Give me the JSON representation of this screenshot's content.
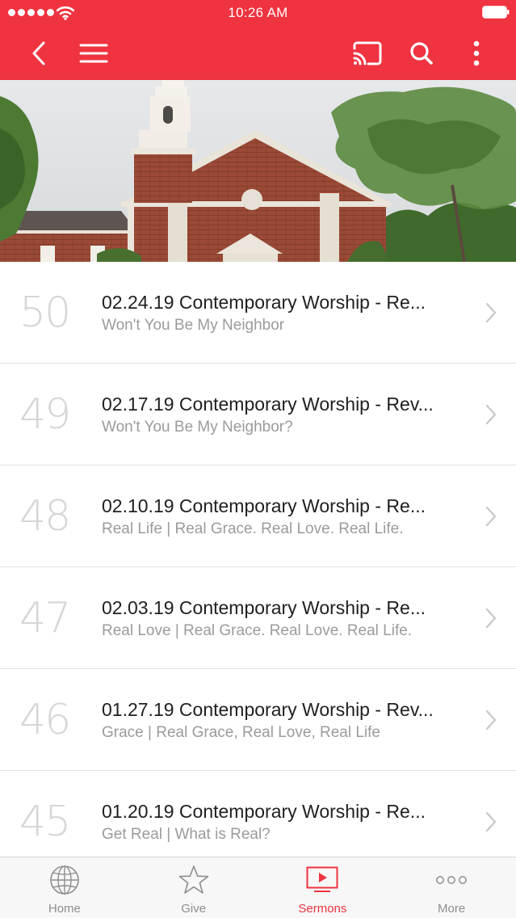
{
  "colors": {
    "accent": "#ef3340",
    "title_text": "#1f1f1f",
    "subtitle_text": "#9b9b9b",
    "number_text": "#d6d6d6",
    "tab_inactive": "#8e8e8e"
  },
  "status_bar": {
    "time": "10:26 AM",
    "signal_icon": "signal-dots-icon",
    "wifi_icon": "wifi-icon",
    "battery_icon": "battery-icon"
  },
  "nav_bar": {
    "back_icon": "chevron-left-icon",
    "menu_icon": "hamburger-menu-icon",
    "cast_icon": "cast-icon",
    "search_icon": "search-icon",
    "more_icon": "vertical-dots-icon"
  },
  "hero": {
    "image": "church-building-photo"
  },
  "sermons": [
    {
      "number": "50",
      "title": "02.24.19 Contemporary Worship - Re...",
      "subtitle": "Won't You Be My Neighbor"
    },
    {
      "number": "49",
      "title": "02.17.19 Contemporary Worship - Rev...",
      "subtitle": "Won't You Be My Neighbor?"
    },
    {
      "number": "48",
      "title": "02.10.19 Contemporary Worship - Re...",
      "subtitle": "Real Life | Real Grace. Real Love. Real Life."
    },
    {
      "number": "47",
      "title": "02.03.19 Contemporary Worship - Re...",
      "subtitle": "Real Love | Real Grace. Real Love. Real Life."
    },
    {
      "number": "46",
      "title": "01.27.19 Contemporary Worship - Rev...",
      "subtitle": "Grace | Real Grace, Real Love, Real Life"
    },
    {
      "number": "45",
      "title": "01.20.19 Contemporary Worship - Re...",
      "subtitle": "Get Real | What is Real?"
    }
  ],
  "tab_bar": {
    "tabs": [
      {
        "label": "Home",
        "icon": "globe-icon",
        "active": false
      },
      {
        "label": "Give",
        "icon": "star-icon",
        "active": false
      },
      {
        "label": "Sermons",
        "icon": "video-play-icon",
        "active": true
      },
      {
        "label": "More",
        "icon": "horizontal-dots-icon",
        "active": false
      }
    ]
  }
}
